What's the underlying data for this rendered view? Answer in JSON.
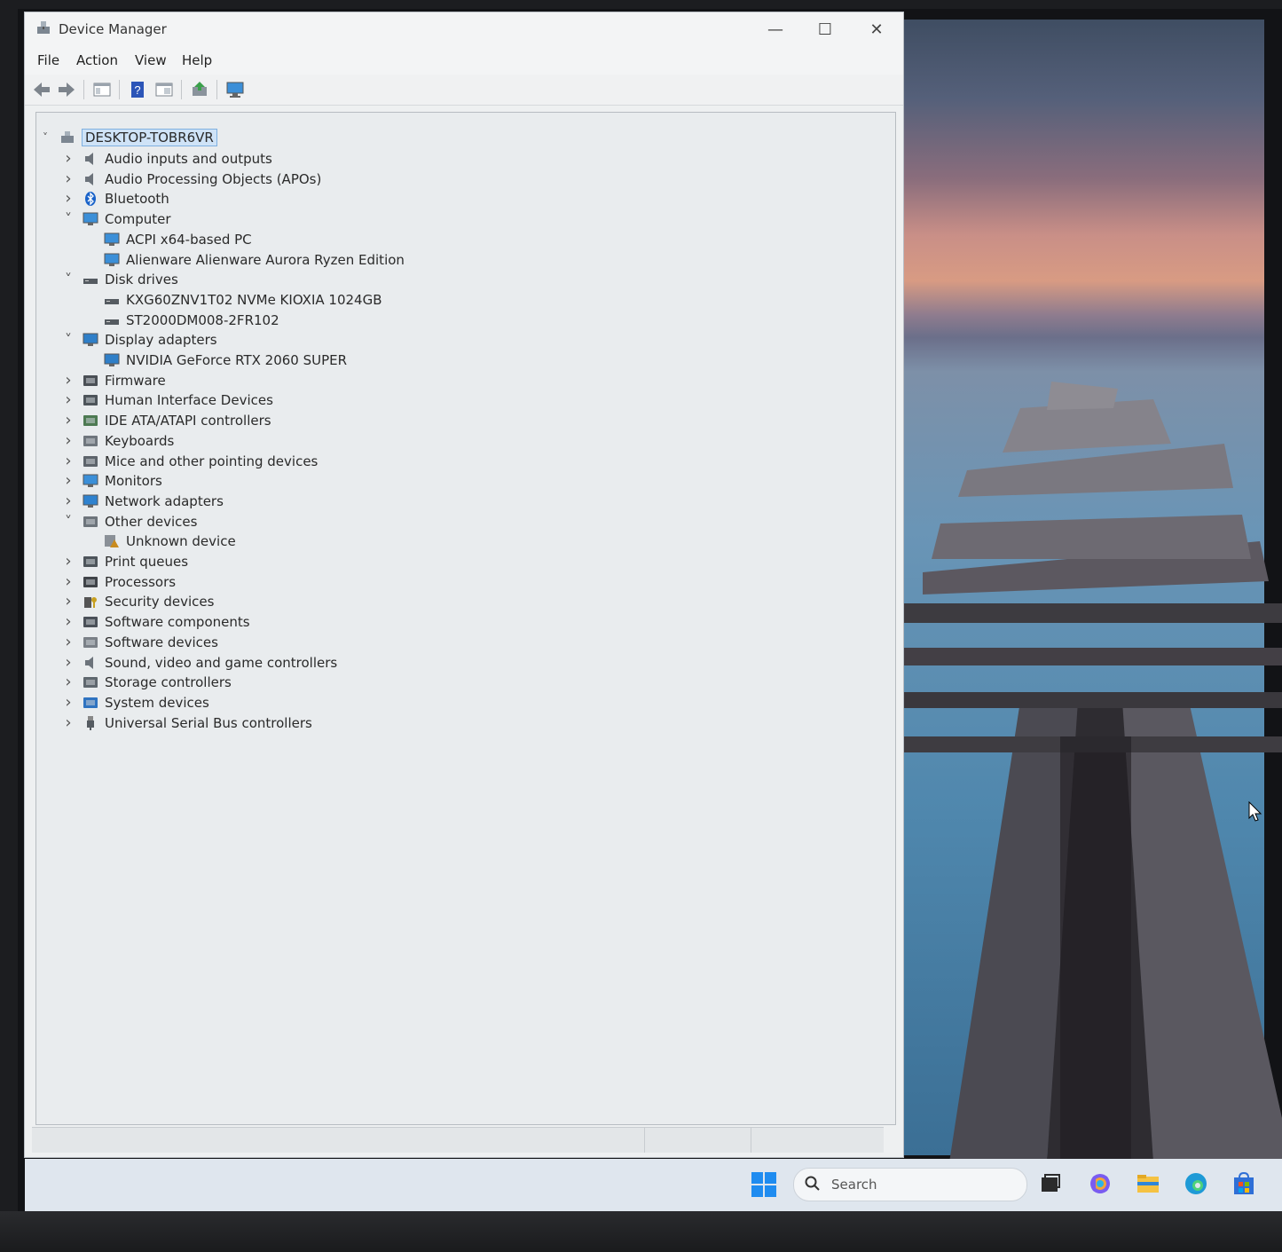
{
  "window": {
    "title": "Device Manager",
    "minimize": "—",
    "maximize": "☐",
    "close": "✕"
  },
  "menu": [
    "File",
    "Action",
    "View",
    "Help"
  ],
  "tree": {
    "root": "DESKTOP-TOBR6VR",
    "nodes": [
      {
        "label": "Audio inputs and outputs",
        "expanded": false,
        "icon": "speaker-icon"
      },
      {
        "label": "Audio Processing Objects (APOs)",
        "expanded": false,
        "icon": "speaker-icon"
      },
      {
        "label": "Bluetooth",
        "expanded": false,
        "icon": "bluetooth-icon"
      },
      {
        "label": "Computer",
        "expanded": true,
        "icon": "monitor-icon"
      },
      {
        "label": "ACPI x64-based PC",
        "child": true,
        "icon": "monitor-icon"
      },
      {
        "label": "Alienware Alienware Aurora Ryzen Edition",
        "child": true,
        "icon": "monitor-icon"
      },
      {
        "label": "Disk drives",
        "expanded": true,
        "icon": "disk-icon"
      },
      {
        "label": "KXG60ZNV1T02 NVMe KIOXIA 1024GB",
        "child": true,
        "icon": "disk-icon"
      },
      {
        "label": "ST2000DM008-2FR102",
        "child": true,
        "icon": "disk-icon"
      },
      {
        "label": "Display adapters",
        "expanded": true,
        "icon": "display-adapter-icon"
      },
      {
        "label": "NVIDIA GeForce RTX 2060 SUPER",
        "child": true,
        "icon": "display-adapter-icon"
      },
      {
        "label": "Firmware",
        "expanded": false,
        "icon": "chip-icon"
      },
      {
        "label": "Human Interface Devices",
        "expanded": false,
        "icon": "hid-icon"
      },
      {
        "label": "IDE ATA/ATAPI controllers",
        "expanded": false,
        "icon": "controller-icon"
      },
      {
        "label": "Keyboards",
        "expanded": false,
        "icon": "keyboard-icon"
      },
      {
        "label": "Mice and other pointing devices",
        "expanded": false,
        "icon": "mouse-icon"
      },
      {
        "label": "Monitors",
        "expanded": false,
        "icon": "monitor-icon"
      },
      {
        "label": "Network adapters",
        "expanded": false,
        "icon": "network-icon"
      },
      {
        "label": "Other devices",
        "expanded": true,
        "icon": "unknown-icon"
      },
      {
        "label": "Unknown device",
        "child": true,
        "icon": "warning-device-icon"
      },
      {
        "label": "Print queues",
        "expanded": false,
        "icon": "printer-icon"
      },
      {
        "label": "Processors",
        "expanded": false,
        "icon": "processor-icon"
      },
      {
        "label": "Security devices",
        "expanded": false,
        "icon": "security-icon"
      },
      {
        "label": "Software components",
        "expanded": false,
        "icon": "component-icon"
      },
      {
        "label": "Software devices",
        "expanded": false,
        "icon": "software-device-icon"
      },
      {
        "label": "Sound, video and game controllers",
        "expanded": false,
        "icon": "speaker-icon"
      },
      {
        "label": "Storage controllers",
        "expanded": false,
        "icon": "storage-icon"
      },
      {
        "label": "System devices",
        "expanded": false,
        "icon": "system-icon"
      },
      {
        "label": "Universal Serial Bus controllers",
        "expanded": false,
        "icon": "usb-icon"
      }
    ]
  },
  "taskbar": {
    "search_placeholder": "Search"
  },
  "colors": {
    "accent": "#0a6cd6",
    "selection": "#cfe3f7"
  }
}
